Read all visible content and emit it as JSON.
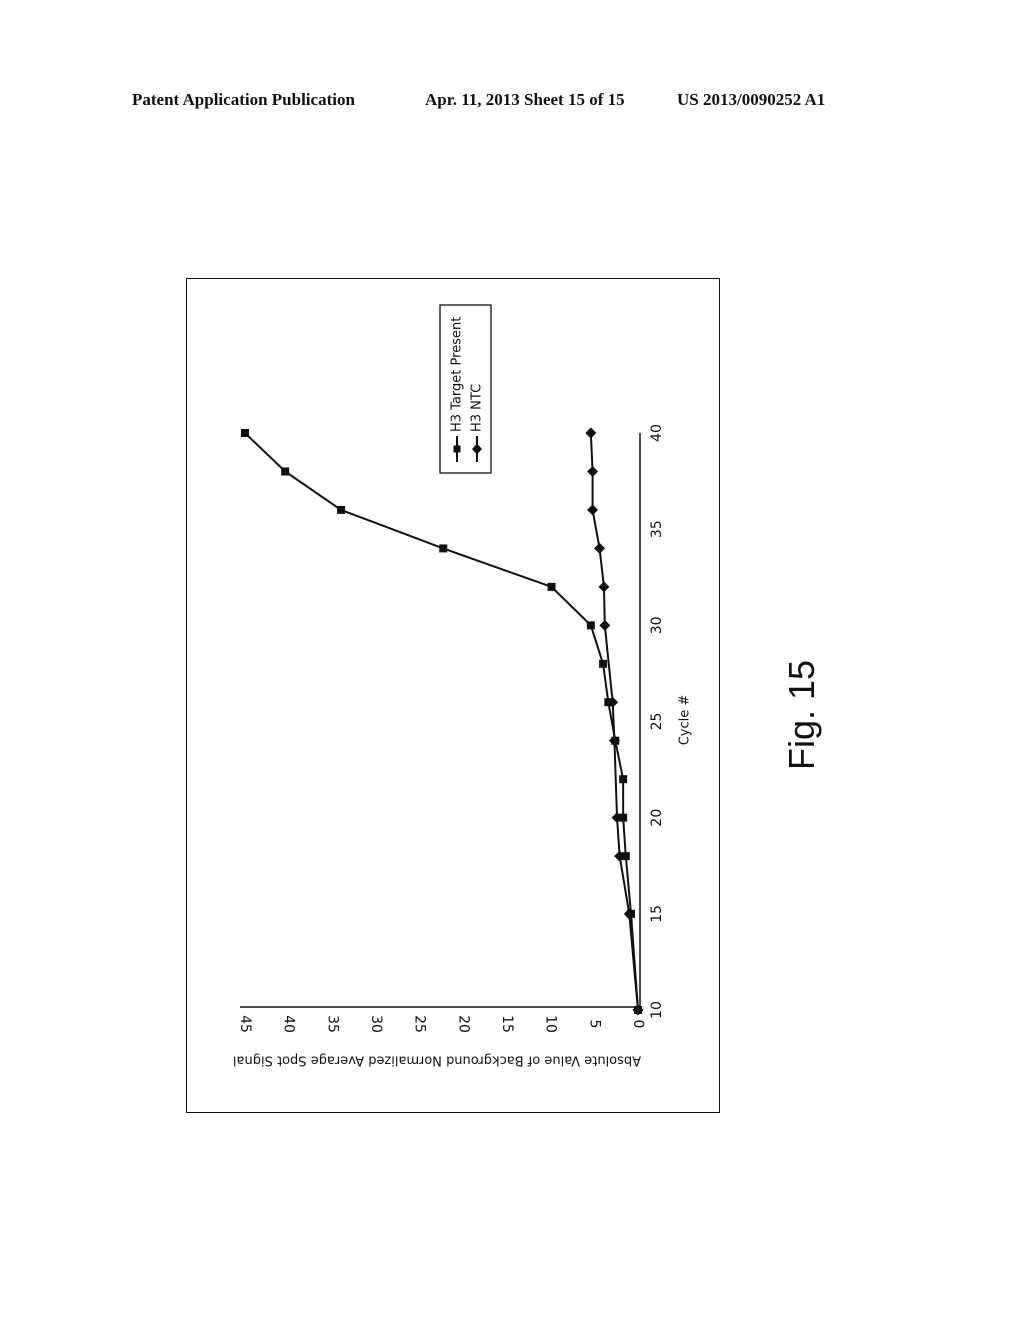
{
  "header": {
    "left": "Patent Application Publication",
    "middle": "Apr. 11, 2013  Sheet 15 of 15",
    "right": "US 2013/0090252 A1"
  },
  "figure_label": "Fig. 15",
  "chart_data": {
    "type": "line",
    "orientation": "rotated 90 degrees clockwise on page",
    "title": "",
    "xlabel": "Cycle #",
    "ylabel": "Absolute Value of Background Normalized Average Spot Signal",
    "xlim": [
      10,
      40
    ],
    "ylim": [
      0,
      45
    ],
    "xticks": [
      "10",
      "15",
      "20",
      "25",
      "30",
      "35",
      "40"
    ],
    "yticks": [
      "0",
      "5",
      "10",
      "15",
      "20",
      "25",
      "30",
      "35",
      "40",
      "45"
    ],
    "grid": false,
    "legend_position": "top-right",
    "series": [
      {
        "name": "H3 Target Present",
        "marker": "square",
        "x": [
          10,
          15,
          18,
          20,
          22,
          24,
          26,
          28,
          30,
          32,
          34,
          36,
          38,
          40
        ],
        "values": [
          0,
          0.8,
          1.4,
          1.7,
          1.7,
          2.6,
          3.4,
          4.0,
          5.4,
          9.9,
          22.3,
          34.0,
          40.4,
          45.0
        ]
      },
      {
        "name": "H3 NTC",
        "marker": "diamond",
        "x": [
          10,
          15,
          18,
          20,
          24,
          26,
          30,
          32,
          34,
          36,
          38,
          40
        ],
        "values": [
          0,
          1.0,
          2.1,
          2.4,
          2.7,
          2.9,
          3.8,
          3.9,
          4.4,
          5.2,
          5.2,
          5.4
        ]
      }
    ]
  }
}
